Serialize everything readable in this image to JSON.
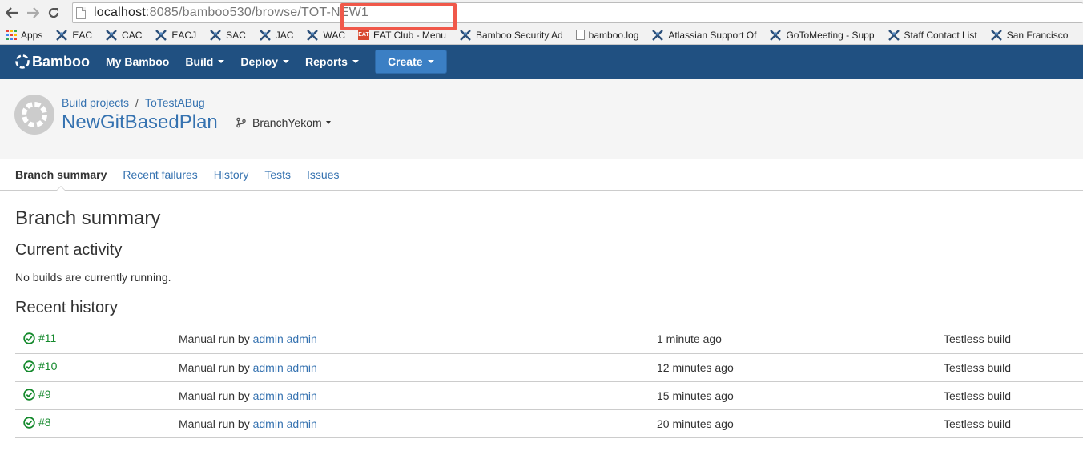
{
  "browser": {
    "url_host": "localhost",
    "url_rest": ":8085/bamboo530/browse/TOT-NEW1",
    "bookmarks": [
      {
        "label": "Apps",
        "icon": "apps-grid-icon"
      },
      {
        "label": "EAC",
        "icon": "atlassian-x-icon"
      },
      {
        "label": "CAC",
        "icon": "atlassian-x-icon"
      },
      {
        "label": "EACJ",
        "icon": "atlassian-x-icon"
      },
      {
        "label": "SAC",
        "icon": "atlassian-x-icon"
      },
      {
        "label": "JAC",
        "icon": "atlassian-x-icon"
      },
      {
        "label": "WAC",
        "icon": "atlassian-x-icon"
      },
      {
        "label": "EAT Club - Menu",
        "icon": "eat-club-icon"
      },
      {
        "label": "Bamboo Security Ad",
        "icon": "atlassian-x-icon"
      },
      {
        "label": "bamboo.log",
        "icon": "document-icon"
      },
      {
        "label": "Atlassian Support Of",
        "icon": "atlassian-x-icon"
      },
      {
        "label": "GoToMeeting - Supp",
        "icon": "atlassian-x-icon"
      },
      {
        "label": "Staff Contact List",
        "icon": "atlassian-x-icon"
      },
      {
        "label": "San Francisco",
        "icon": "atlassian-x-icon"
      }
    ]
  },
  "header": {
    "logo": "Bamboo",
    "nav": [
      {
        "label": "My Bamboo",
        "dropdown": false
      },
      {
        "label": "Build",
        "dropdown": true
      },
      {
        "label": "Deploy",
        "dropdown": true
      },
      {
        "label": "Reports",
        "dropdown": true
      }
    ],
    "create_label": "Create",
    "color": "#205081"
  },
  "page_header": {
    "breadcrumb_1": "Build projects",
    "breadcrumb_sep": "/",
    "breadcrumb_2": "ToTestABug",
    "title": "NewGitBasedPlan",
    "branch": "BranchYekom"
  },
  "tabs": [
    {
      "label": "Branch summary",
      "active": true
    },
    {
      "label": "Recent failures",
      "active": false
    },
    {
      "label": "History",
      "active": false
    },
    {
      "label": "Tests",
      "active": false
    },
    {
      "label": "Issues",
      "active": false
    }
  ],
  "content": {
    "heading": "Branch summary",
    "current_activity_heading": "Current activity",
    "current_activity_text": "No builds are currently running.",
    "recent_history_heading": "Recent history",
    "history": [
      {
        "build": "#11",
        "reason_prefix": "Manual run by ",
        "user": "admin admin",
        "time": "1 minute ago",
        "result": "Testless build"
      },
      {
        "build": "#10",
        "reason_prefix": "Manual run by ",
        "user": "admin admin",
        "time": "12 minutes ago",
        "result": "Testless build"
      },
      {
        "build": "#9",
        "reason_prefix": "Manual run by ",
        "user": "admin admin",
        "time": "15 minutes ago",
        "result": "Testless build"
      },
      {
        "build": "#8",
        "reason_prefix": "Manual run by ",
        "user": "admin admin",
        "time": "20 minutes ago",
        "result": "Testless build"
      }
    ]
  },
  "colors": {
    "success": "#14892c",
    "link": "#3572b0",
    "highlight": "#f0584a"
  }
}
